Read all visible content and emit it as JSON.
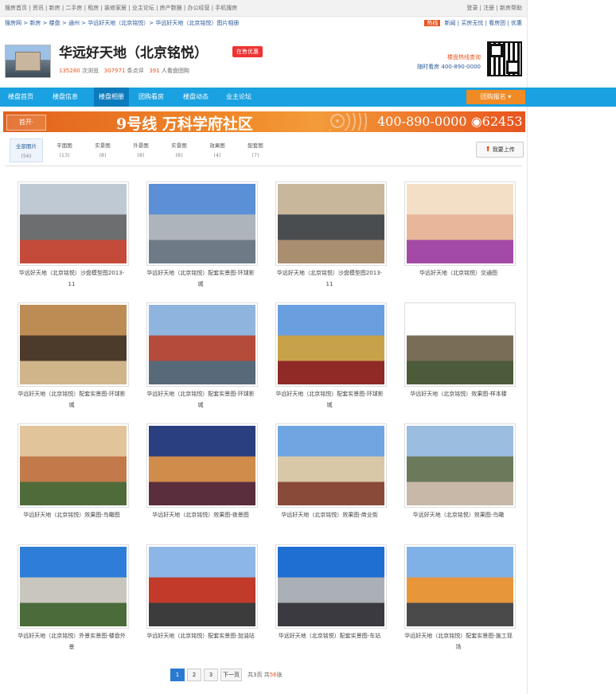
{
  "topbar": {
    "left_links": "搜房首页 | 资讯 | 新房 | 二手房 | 租房 | 装修家居 | 业主论坛 | 房产数据 | 办公经营 | 手机搜房",
    "right_links": "登录 | 注册 | 新房帮助"
  },
  "breadcrumb": {
    "path": "搜房网 > 新房 > 楼盘 > 通州 > 华远好天地（北京铭悦）> 华远好天地（北京铭悦）图片相册",
    "right_tag": "热线",
    "right_links": "新闻 | 买房无忧 | 看房团 | 优惠"
  },
  "header": {
    "title": "华远好天地（北京铭悦）",
    "sale_tag": "在售优惠",
    "stats_prefix": "",
    "visits": "135280",
    "visits_label": "次浏览",
    "comments": "307971",
    "comments_label": "条点评",
    "members": "391",
    "members_label": "人看盘团购",
    "promo_line1": "楼盘热线查询",
    "promo_line2": "随时看房 400-890-0000"
  },
  "nav": {
    "items": [
      "楼盘首页",
      "楼盘信息",
      "楼盘相册",
      "团购看房",
      "楼盘动态",
      "业主论坛"
    ],
    "active_index": 2,
    "button_label": "团购报名 ▾"
  },
  "banner": {
    "logo": "首开·",
    "headline": "9号线 万科学府社区",
    "phone": "400-890-0000 ◉62453"
  },
  "tabs": [
    {
      "label": "全部图片",
      "count": "(56)"
    },
    {
      "label": "平面图",
      "count": "(13)"
    },
    {
      "label": "实景图",
      "count": "(8)"
    },
    {
      "label": "外景图",
      "count": "(8)"
    },
    {
      "label": "实景图",
      "count": "(8)"
    },
    {
      "label": "效果图",
      "count": "(4)"
    },
    {
      "label": "配套图",
      "count": "(7)"
    }
  ],
  "upload_label": "我要上传",
  "photos": [
    {
      "caption": "华远好天地（北京铭悦）沙盘模型图2013-11",
      "palette": [
        "#bfc9d3",
        "#6d6e70",
        "#c44b3a"
      ]
    },
    {
      "caption": "华远好天地（北京铭悦）配套实景图-环球影城",
      "palette": [
        "#5b8fd6",
        "#aeb4bb",
        "#6e7a86"
      ]
    },
    {
      "caption": "华远好天地（北京铭悦）沙盘模型图2013-11",
      "palette": [
        "#c9b79c",
        "#4a4d50",
        "#a98f70"
      ]
    },
    {
      "caption": "华远好天地（北京铭悦）交通图",
      "palette": [
        "#f3dfc6",
        "#e8b79a",
        "#a34aa6"
      ]
    },
    {
      "caption": "华远好天地（北京铭悦）配套实景图-环球影城",
      "palette": [
        "#bd8b54",
        "#4c3a2a",
        "#d0b48a"
      ]
    },
    {
      "caption": "华远好天地（北京铭悦）配套实景图-环球影城",
      "palette": [
        "#8fb5de",
        "#b54b3a",
        "#586a7a"
      ]
    },
    {
      "caption": "华远好天地（北京铭悦）配套实景图-环球影城",
      "palette": [
        "#6a9fdf",
        "#c7a24b",
        "#8f2a26"
      ]
    },
    {
      "caption": "华远好天地（北京铭悦）效果图-样本楼",
      "palette": [
        "#ffffff",
        "#7a6d58",
        "#4c5b3a"
      ]
    },
    {
      "caption": "华远好天地（北京铭悦）效果图-鸟瞰图",
      "palette": [
        "#e2c49a",
        "#c27a4a",
        "#4f6b3a"
      ]
    },
    {
      "caption": "华远好天地（北京铭悦）效果图-夜景图",
      "palette": [
        "#2a3f80",
        "#d08c4a",
        "#5b2e3e"
      ]
    },
    {
      "caption": "华远好天地（北京铭悦）效果图-商业街",
      "palette": [
        "#6fa5e0",
        "#d9c8a8",
        "#8a4a3a"
      ]
    },
    {
      "caption": "华远好天地（北京铭悦）效果图-鸟瞰",
      "palette": [
        "#9bbde0",
        "#6b7a5a",
        "#c8b8a8"
      ]
    },
    {
      "caption": "华远好天地（北京铭悦）外景实景图-楼盘外景",
      "palette": [
        "#2e7dd6",
        "#c9c6bd",
        "#4b6b3a"
      ]
    },
    {
      "caption": "华远好天地（北京铭悦）配套实景图-加油站",
      "palette": [
        "#8cb6e6",
        "#c23a2a",
        "#3c3c3c"
      ]
    },
    {
      "caption": "华远好天地（北京铭悦）配套实景图-车站",
      "palette": [
        "#1f6fd2",
        "#aab0b5",
        "#3a3a40"
      ]
    },
    {
      "caption": "华远好天地（北京铭悦）配套实景图-施工现场",
      "palette": [
        "#7fb1e6",
        "#e8963a",
        "#4a4a4a"
      ]
    }
  ],
  "pager": {
    "pages": [
      "1",
      "2",
      "3",
      "下一页"
    ],
    "active": "1",
    "total_prefix": "共3页",
    "total_label": "共",
    "total_count": "56",
    "total_suffix": "张"
  }
}
